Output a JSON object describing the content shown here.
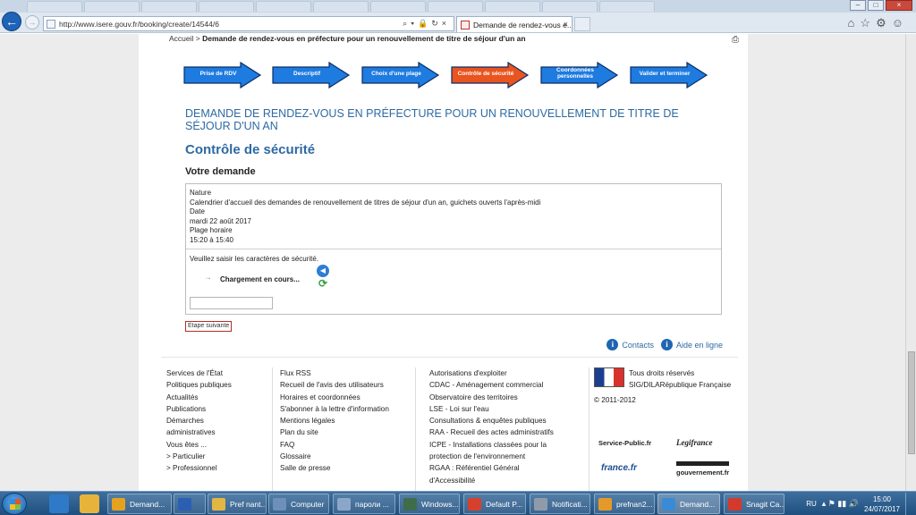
{
  "browser": {
    "url": "http://www.isere.gouv.fr/booking/create/14544/6",
    "active_tab": "Demande de rendez-vous e...",
    "active_tab_close": "×",
    "background_tabs": [
      "",
      "",
      "",
      "",
      "",
      "",
      "",
      "",
      "",
      "",
      ""
    ],
    "window_buttons": {
      "minimize": "–",
      "maximize": "□",
      "close": "×"
    }
  },
  "breadcrumb": {
    "home": "Accueil",
    "sep": " > ",
    "current": "Demande de rendez-vous en préfecture pour un renouvellement de titre de séjour d'un an"
  },
  "steps": [
    {
      "label": "Prise de RDV",
      "state": "done",
      "color": "#1e7be0"
    },
    {
      "label": "Descriptif",
      "state": "done",
      "color": "#1e7be0"
    },
    {
      "label": "Choix d'une plage",
      "state": "done",
      "color": "#1e7be0"
    },
    {
      "label": "Contrôle de sécurité",
      "state": "active",
      "color": "#e9541f"
    },
    {
      "label": "Coordonnées personnelles",
      "state": "todo",
      "color": "#1e7be0"
    },
    {
      "label": "Valider et terminer",
      "state": "todo",
      "color": "#1e7be0"
    }
  ],
  "main_title": "DEMANDE DE RENDEZ-VOUS EN PRÉFECTURE POUR UN RENOUVELLEMENT DE TITRE DE SÉJOUR D'UN AN",
  "section_title": "Contrôle de sécurité",
  "sub_title": "Votre demande",
  "request": {
    "nature_label": "Nature",
    "nature_value": "Calendrier d'accueil des demandes de renouvellement de titres de séjour d'un an, guichets ouverts l'après-midi",
    "date_label": "Date",
    "date_value": "mardi 22 août 2017",
    "slot_label": "Plage horaire",
    "slot_value": "15:20 à 15:40"
  },
  "captcha": {
    "instruction": "Veuillez saisir les caractères de sécurité.",
    "loading": "Chargement en cours...",
    "input_value": ""
  },
  "next_button": "Etape suivante",
  "help_links": {
    "contacts": "Contacts",
    "help": "Aide en ligne"
  },
  "footer": {
    "col1": [
      "Services de l'État",
      "Politiques publiques",
      "Actualités",
      "Publications",
      "Démarches",
      "administratives",
      "Vous êtes ...",
      "> Particulier",
      "> Professionnel"
    ],
    "col2": [
      "Flux RSS",
      "Recueil de l'avis des utilisateurs",
      "Horaires et coordonnées",
      "S'abonner à la lettre d'information",
      "Mentions légales",
      "Plan du site",
      "FAQ",
      "Glossaire",
      "Salle de presse"
    ],
    "col3": [
      "Autorisations d'exploiter",
      "CDAC - Aménagement commercial",
      "Observatoire des territoires",
      "LSE - Loi sur l'eau",
      "Consultations & enquêtes publiques",
      "RAA - Recueil des actes administratifs",
      "ICPE - Installations classées pour la",
      "protection de l'environnement",
      "RGAA : Référentiel Général d'Accessibilité"
    ],
    "rights": "Tous droits réservés",
    "sig": "SIG/DILARépublique Française",
    "copyright": "© 2011-2012",
    "logos": {
      "service_public": "Service-Public.fr",
      "legifrance": "Legifrance",
      "france_fr": "france.fr",
      "gouvernement": "gouvernement.fr"
    }
  },
  "taskbar": {
    "items": [
      {
        "label": "Demand...",
        "color": "#e5a21f"
      },
      {
        "label": "",
        "color": "#2b5fb4"
      },
      {
        "label": "Pref nant...",
        "color": "#e2b642"
      },
      {
        "label": "Computer",
        "color": "#6d8fb8"
      },
      {
        "label": "пароли ...",
        "color": "#8aa7c9"
      },
      {
        "label": "Windows...",
        "color": "#3f6c4a"
      },
      {
        "label": "Default P...",
        "color": "#d6402f"
      },
      {
        "label": "Notificati...",
        "color": "#8f9bab"
      },
      {
        "label": "prefnan2...",
        "color": "#e39a2a"
      },
      {
        "label": "Demand...",
        "color": "#3a8ad6"
      },
      {
        "label": "Snagit Ca...",
        "color": "#d33a2c"
      }
    ],
    "lang": "RU",
    "time": "15:00",
    "date": "24/07/2017"
  }
}
